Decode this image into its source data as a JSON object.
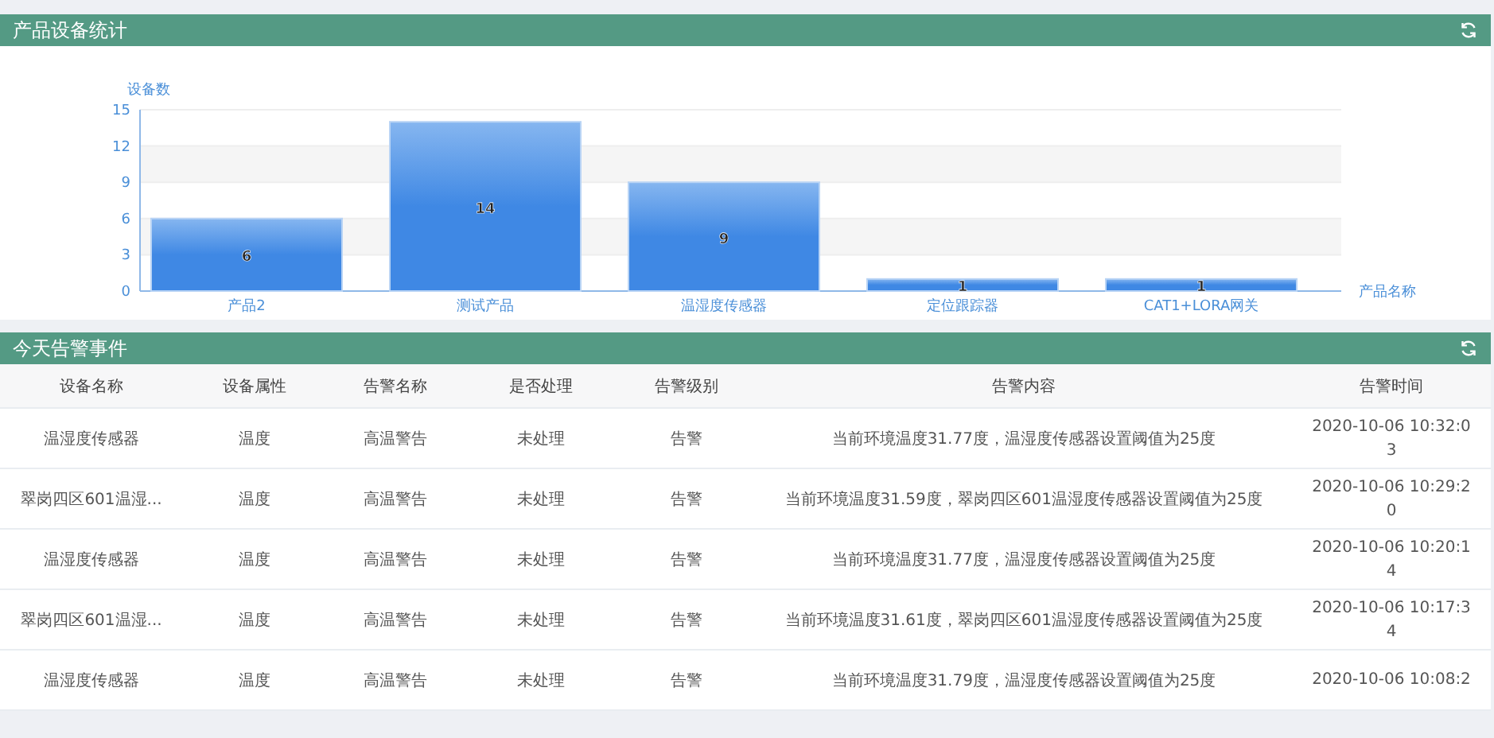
{
  "device_panel": {
    "title": "产品设备统计",
    "chart_data": {
      "type": "bar",
      "ylabel": "设备数",
      "xlabel": "产品名称",
      "categories": [
        "产品2",
        "测试产品",
        "温湿度传感器",
        "定位跟踪器",
        "CAT1+LORA网关"
      ],
      "values": [
        6,
        14,
        9,
        1,
        1
      ],
      "ylim": [
        0,
        15
      ],
      "yticks": [
        0,
        3,
        6,
        9,
        12,
        15
      ],
      "data_labels": true,
      "grid": true
    }
  },
  "alarm_panel": {
    "title": "今天告警事件",
    "columns": [
      "设备名称",
      "设备属性",
      "告警名称",
      "是否处理",
      "告警级别",
      "告警内容",
      "告警时间"
    ],
    "rows": [
      [
        "温湿度传感器",
        "温度",
        "高温警告",
        "未处理",
        "告警",
        "当前环境温度31.77度，温湿度传感器设置阈值为25度",
        "2020-10-06 10:32:03"
      ],
      [
        "翠岗四区601温湿...",
        "温度",
        "高温警告",
        "未处理",
        "告警",
        "当前环境温度31.59度，翠岗四区601温湿度传感器设置阈值为25度",
        "2020-10-06 10:29:20"
      ],
      [
        "温湿度传感器",
        "温度",
        "高温警告",
        "未处理",
        "告警",
        "当前环境温度31.77度，温湿度传感器设置阈值为25度",
        "2020-10-06 10:20:14"
      ],
      [
        "翠岗四区601温湿...",
        "温度",
        "高温警告",
        "未处理",
        "告警",
        "当前环境温度31.61度，翠岗四区601温湿度传感器设置阈值为25度",
        "2020-10-06 10:17:34"
      ],
      [
        "温湿度传感器",
        "温度",
        "高温警告",
        "未处理",
        "告警",
        "当前环境温度31.79度，温湿度传感器设置阈值为25度",
        "2020-10-06 10:08:2"
      ]
    ]
  }
}
